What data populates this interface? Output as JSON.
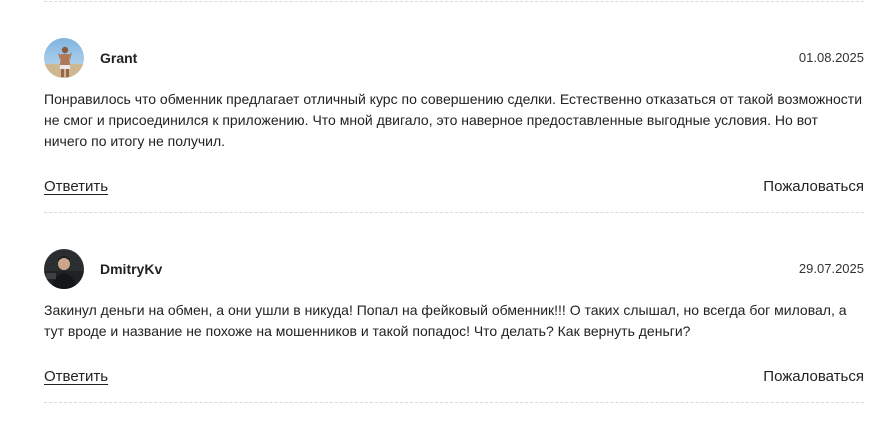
{
  "comments": [
    {
      "author": "Grant",
      "date": "01.08.2025",
      "text": "Понравилось что обменник предлагает отличный курс по совершению сделки. Естественно отказаться от такой возможности не смог и присоединился к приложению. Что мной двигало, это наверное предоставленные выгодные условия. Но вот ничего по итогу не получил.",
      "reply_label": "Ответить",
      "report_label": "Пожаловаться",
      "avatar_icon": "user-photo-beach"
    },
    {
      "author": "DmitryKv",
      "date": "29.07.2025",
      "text": "Закинул деньги на обмен, а они ушли в никуда! Попал на фейковый обменник!!! О таких слышал, но всегда бог миловал, а тут вроде и название не похоже на мошенников и такой попадос! Что делать? Как вернуть деньги?",
      "reply_label": "Ответить",
      "report_label": "Пожаловаться",
      "avatar_icon": "user-photo-dark"
    }
  ]
}
